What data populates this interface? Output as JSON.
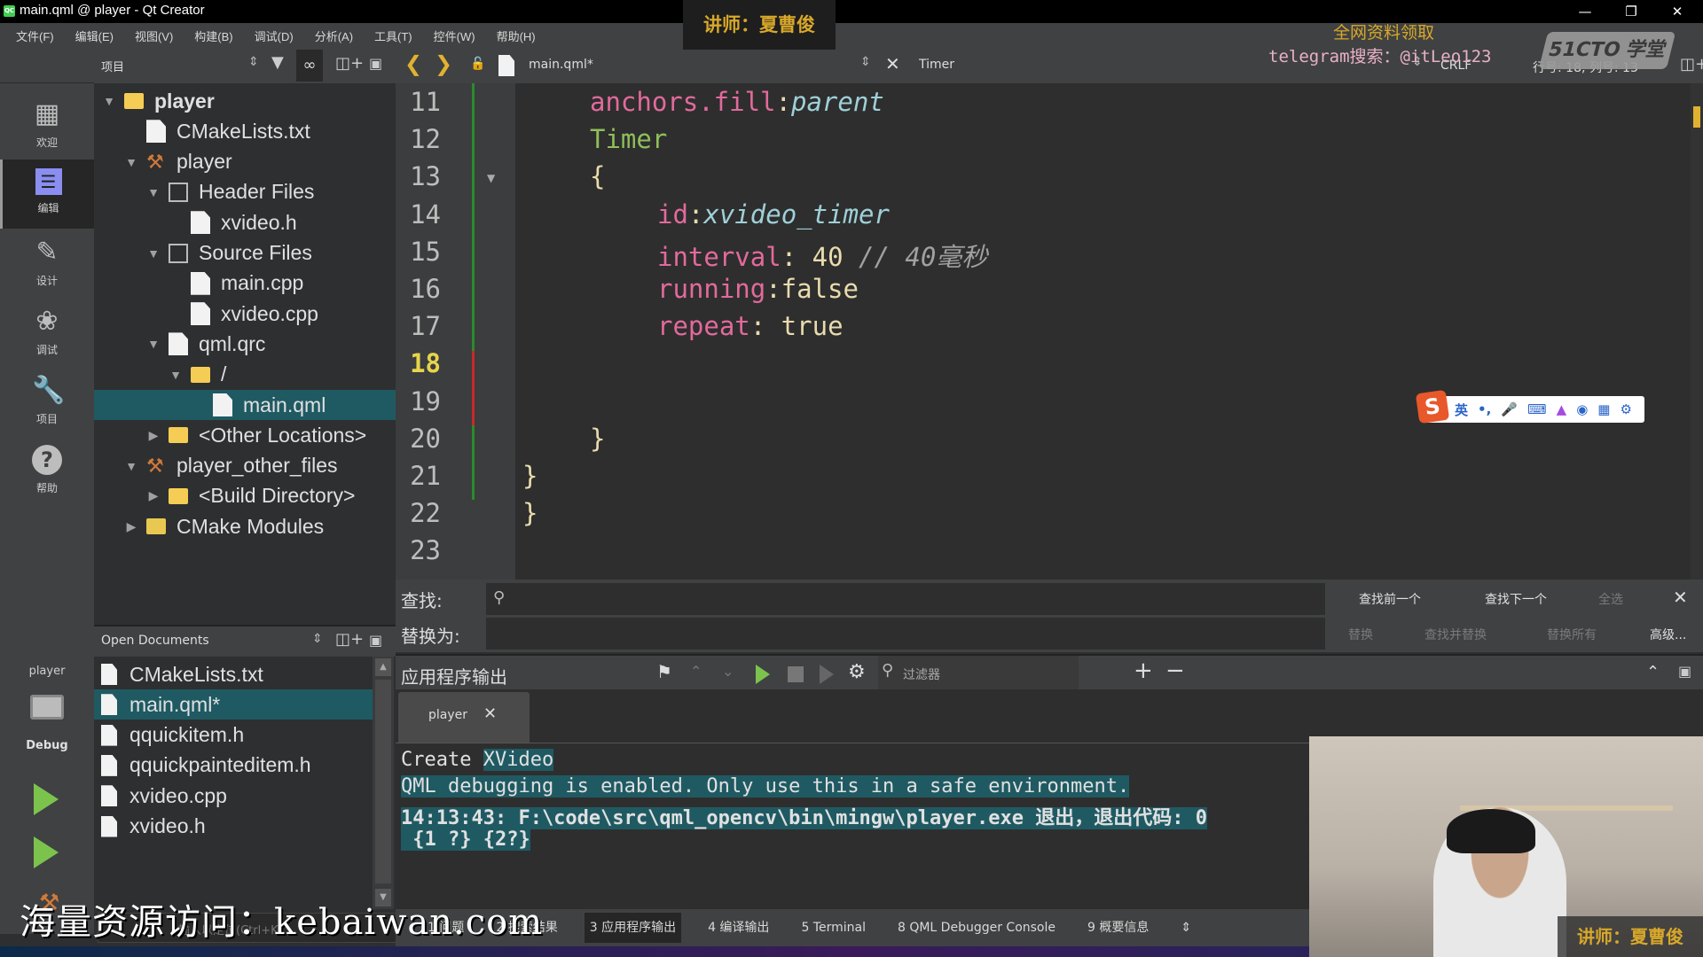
{
  "window": {
    "title": "main.qml @ player - Qt Creator",
    "app_icon": "qt-icon",
    "controls": [
      "minimize-icon",
      "restore-icon",
      "close-icon"
    ]
  },
  "menu": [
    "文件(F)",
    "编辑(E)",
    "视图(V)",
    "构建(B)",
    "调试(D)",
    "分析(A)",
    "工具(T)",
    "控件(W)",
    "帮助(H)"
  ],
  "overlays": {
    "teacher_top": "讲师：夏曹俊",
    "promo_line1": "全网资料领取",
    "promo_line2": "telegram搜索：@itLeo123",
    "logo": "51CTO 学堂",
    "watermark": "海量资源访问：kebaiwan.com",
    "webcam_caption": "讲师：夏曹俊"
  },
  "modes": [
    {
      "label": "欢迎",
      "icon": "grid-icon"
    },
    {
      "label": "编辑",
      "icon": "edit-document-icon",
      "active": true
    },
    {
      "label": "设计",
      "icon": "pencil-icon"
    },
    {
      "label": "调试",
      "icon": "bug-icon"
    },
    {
      "label": "项目",
      "icon": "wrench-icon"
    },
    {
      "label": "帮助",
      "icon": "help-icon"
    }
  ],
  "kit": {
    "project": "player",
    "build_type": "Debug",
    "run_icon": "run-icon",
    "debug_run_icon": "debug-run-icon",
    "build_icon": "hammer-icon"
  },
  "project_pane": {
    "selector": "项目",
    "tree": [
      {
        "label": "player",
        "depth": 0,
        "arrow": "down",
        "icon": "project-folder-icon",
        "bold": true
      },
      {
        "label": "CMakeLists.txt",
        "depth": 1,
        "arrow": "",
        "icon": "cmake-icon"
      },
      {
        "label": "player",
        "depth": 1,
        "arrow": "down",
        "icon": "hammer-icon"
      },
      {
        "label": "Header Files",
        "depth": 2,
        "arrow": "down",
        "icon": "header-group-icon"
      },
      {
        "label": "xvideo.h",
        "depth": 3,
        "arrow": "",
        "icon": "h-file-icon"
      },
      {
        "label": "Source Files",
        "depth": 2,
        "arrow": "down",
        "icon": "source-group-icon"
      },
      {
        "label": "main.cpp",
        "depth": 3,
        "arrow": "",
        "icon": "cpp-file-icon"
      },
      {
        "label": "xvideo.cpp",
        "depth": 3,
        "arrow": "",
        "icon": "cpp-file-icon"
      },
      {
        "label": "qml.qrc",
        "depth": 2,
        "arrow": "down",
        "icon": "qrc-file-icon"
      },
      {
        "label": "/",
        "depth": 3,
        "arrow": "down",
        "icon": "folder-icon"
      },
      {
        "label": "main.qml",
        "depth": 4,
        "arrow": "",
        "icon": "qml-file-icon",
        "selected": true
      },
      {
        "label": "<Other Locations>",
        "depth": 2,
        "arrow": "right",
        "icon": "folder-icon"
      },
      {
        "label": "player_other_files",
        "depth": 1,
        "arrow": "down",
        "icon": "hammer-icon"
      },
      {
        "label": "<Build Directory>",
        "depth": 2,
        "arrow": "right",
        "icon": "folder-icon"
      },
      {
        "label": "CMake Modules",
        "depth": 1,
        "arrow": "right",
        "icon": "cmake-modules-icon"
      }
    ]
  },
  "open_documents": {
    "title": "Open Documents",
    "items": [
      {
        "label": "CMakeLists.txt",
        "icon": "cmake-icon"
      },
      {
        "label": "main.qml*",
        "icon": "qml-file-icon",
        "selected": true
      },
      {
        "label": "qquickitem.h",
        "icon": "h-file-icon"
      },
      {
        "label": "qquickpainteditem.h",
        "icon": "h-file-icon"
      },
      {
        "label": "xvideo.cpp",
        "icon": "cpp-file-icon"
      },
      {
        "label": "xvideo.h",
        "icon": "h-file-icon"
      }
    ],
    "locator_placeholder": "输入以定位(Ctrl+K)"
  },
  "editor": {
    "file": "main.qml*",
    "symbol": "Timer",
    "line_ending": "CRLF",
    "cursor": "行号: 18, 列号: 13",
    "current_line": 18,
    "lines": [
      {
        "n": 11,
        "indent": 2,
        "tokens": [
          {
            "t": "anchors.fill",
            "c": "prop"
          },
          {
            "t": ":",
            "c": "val"
          },
          {
            "t": "parent",
            "c": "italic"
          }
        ]
      },
      {
        "n": 12,
        "indent": 2,
        "tokens": [
          {
            "t": "Timer",
            "c": "type"
          }
        ]
      },
      {
        "n": 13,
        "indent": 2,
        "fold": true,
        "tokens": [
          {
            "t": "{",
            "c": "brace"
          }
        ]
      },
      {
        "n": 14,
        "indent": 3,
        "tokens": [
          {
            "t": "id",
            "c": "prop"
          },
          {
            "t": ":",
            "c": "val"
          },
          {
            "t": "xvideo_timer",
            "c": "italic"
          }
        ]
      },
      {
        "n": 15,
        "indent": 3,
        "tokens": [
          {
            "t": "interval",
            "c": "prop"
          },
          {
            "t": ": 40 ",
            "c": "val"
          },
          {
            "t": "// 40毫秒",
            "c": "comment"
          }
        ]
      },
      {
        "n": 16,
        "indent": 3,
        "tokens": [
          {
            "t": "running",
            "c": "prop"
          },
          {
            "t": ":false",
            "c": "val"
          }
        ]
      },
      {
        "n": 17,
        "indent": 3,
        "tokens": [
          {
            "t": "repeat",
            "c": "prop"
          },
          {
            "t": ": true",
            "c": "val"
          }
        ]
      },
      {
        "n": 18,
        "indent": 0,
        "tokens": []
      },
      {
        "n": 19,
        "indent": 0,
        "tokens": []
      },
      {
        "n": 20,
        "indent": 2,
        "tokens": [
          {
            "t": "}",
            "c": "brace"
          }
        ]
      },
      {
        "n": 21,
        "indent": 1,
        "tokens": [
          {
            "t": "}",
            "c": "brace"
          }
        ]
      },
      {
        "n": 22,
        "indent": 0,
        "tokens": [
          {
            "t": "}",
            "c": "brace"
          }
        ]
      },
      {
        "n": 23,
        "indent": 0,
        "tokens": []
      }
    ]
  },
  "find": {
    "find_label": "查找:",
    "replace_label": "替换为:",
    "find_value": "",
    "replace_value": "",
    "find_prev": "查找前一个",
    "find_next": "查找下一个",
    "select_all": "全选",
    "replace": "替换",
    "find_replace": "查找并替换",
    "replace_all": "替换所有",
    "advanced": "高级..."
  },
  "output": {
    "title": "应用程序输出",
    "filter_placeholder": "过滤器",
    "tab": "player",
    "lines": [
      {
        "text": "Create ",
        "hl_text": "XVideo"
      },
      {
        "text": "",
        "hl_text": "QML debugging is enabled. Only use this in a safe environment."
      },
      {
        "text": "",
        "hl_text": "14:13:43: F:\\code\\src\\qml_opencv\\bin\\mingw\\player.exe 退出，退出代码: 0",
        "bold": true
      },
      {
        "text": "",
        "hl_text": " {1 ?} {2?}",
        "bold": true
      }
    ]
  },
  "status_tabs": [
    {
      "label": "1  问题"
    },
    {
      "label": "2  搜索结果"
    },
    {
      "label": "3  应用程序输出",
      "active": true
    },
    {
      "label": "4  编译输出"
    },
    {
      "label": "5  Terminal"
    },
    {
      "label": "8  QML Debugger Console"
    },
    {
      "label": "9  概要信息"
    }
  ],
  "ime": {
    "logo": "S",
    "mode": "英",
    "items": [
      "•,",
      "mic-icon",
      "keyboard-icon",
      "skin-icon",
      "game-icon",
      "apps-icon",
      "settings-icon"
    ]
  }
}
